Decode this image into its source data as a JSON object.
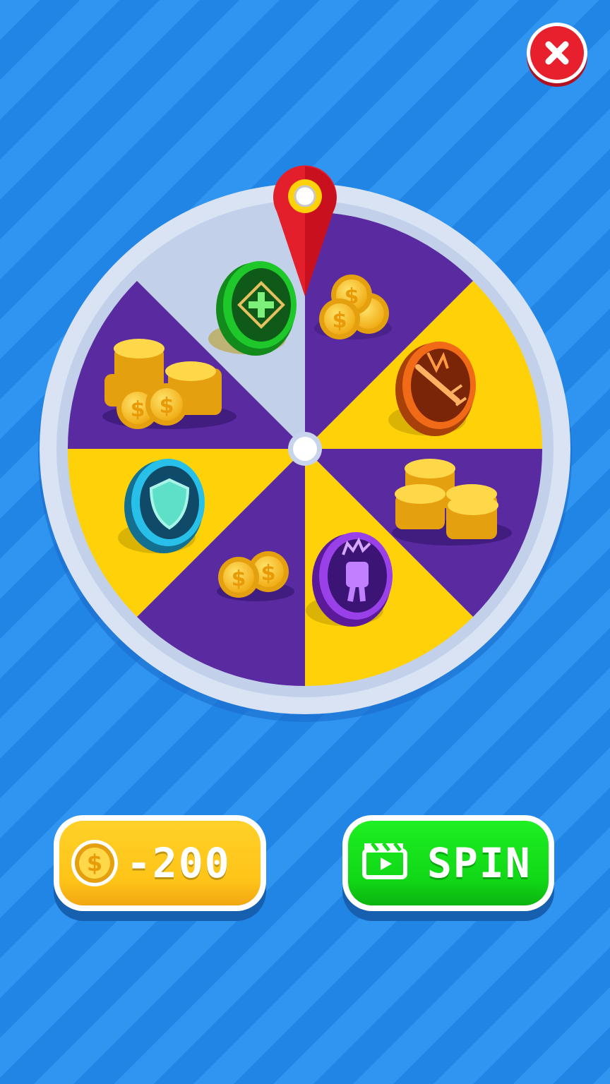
{
  "close_button": {
    "icon": "close-icon",
    "color": "#e8202e"
  },
  "wheel": {
    "colors": {
      "yellow": "#ffd108",
      "purple": "#5a2aa0",
      "rim": "#d7e2f4",
      "pointer": "#e41f2c"
    },
    "segments": [
      {
        "index": 0,
        "color": "yellow",
        "reward": "heal-token"
      },
      {
        "index": 1,
        "color": "purple",
        "reward": "coins-small"
      },
      {
        "index": 2,
        "color": "yellow",
        "reward": "sword-token"
      },
      {
        "index": 3,
        "color": "purple",
        "reward": "coins-large"
      },
      {
        "index": 4,
        "color": "yellow",
        "reward": "power-fist-token"
      },
      {
        "index": 5,
        "color": "purple",
        "reward": "coins-small"
      },
      {
        "index": 6,
        "color": "yellow",
        "reward": "shield-token"
      },
      {
        "index": 7,
        "color": "purple",
        "reward": "coins-large"
      }
    ]
  },
  "buttons": {
    "coin_cost_label": "-200",
    "spin_label": "SPIN"
  }
}
